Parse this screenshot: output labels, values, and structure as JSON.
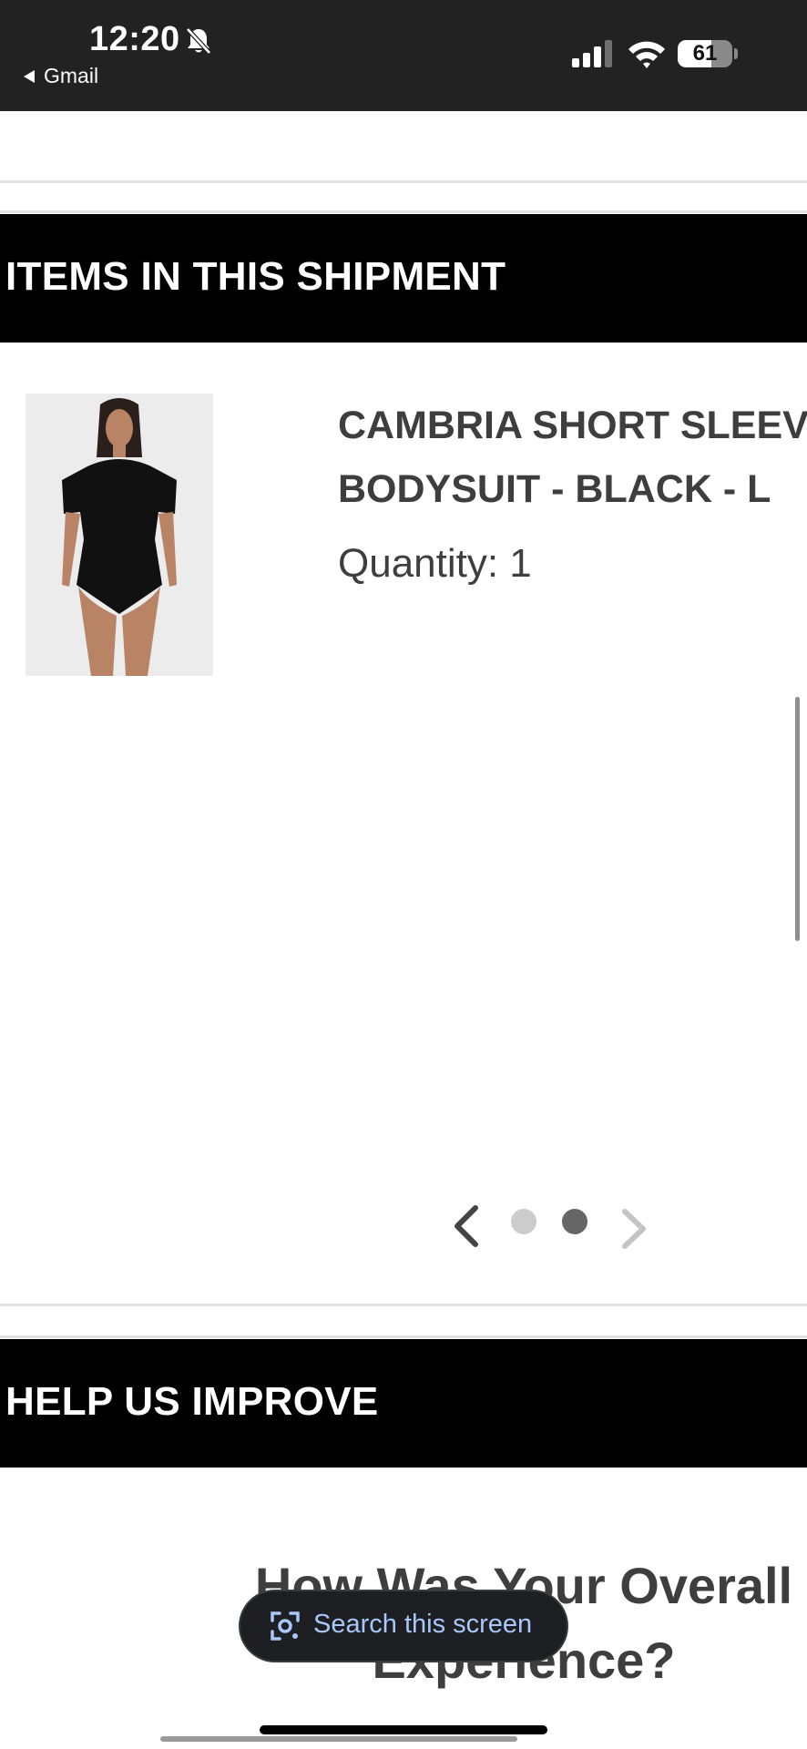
{
  "status_bar": {
    "time": "12:20",
    "back_app": "Gmail",
    "battery_level": "61",
    "battery_fraction": 0.61,
    "icons": [
      "bell-slash-icon",
      "signal-icon",
      "wifi-icon",
      "battery-icon"
    ]
  },
  "shipment": {
    "header": "ITEMS IN THIS SHIPMENT",
    "item": {
      "name": "CAMBRIA SHORT SLEEVE\nBODYSUIT - BLACK - L",
      "quantity": "Quantity: 1"
    },
    "carousel": {
      "page_count": 2,
      "active_page": 2,
      "prev_icon": "chevron-left-icon",
      "next_icon": "chevron-right-icon"
    }
  },
  "improve": {
    "header": "HELP US IMPROVE",
    "question": "How Was Your Overall\nExperience?"
  },
  "overlay": {
    "search_label": "Search this screen",
    "icon": "lens-icon"
  },
  "colors": {
    "status_bar_bg": "#222222",
    "section_header_bg": "#000000",
    "text_dark": "#3e3e3e",
    "dot_active": "#666666",
    "dot_inactive": "#cccccc",
    "search_label": "#a8c7fa"
  }
}
